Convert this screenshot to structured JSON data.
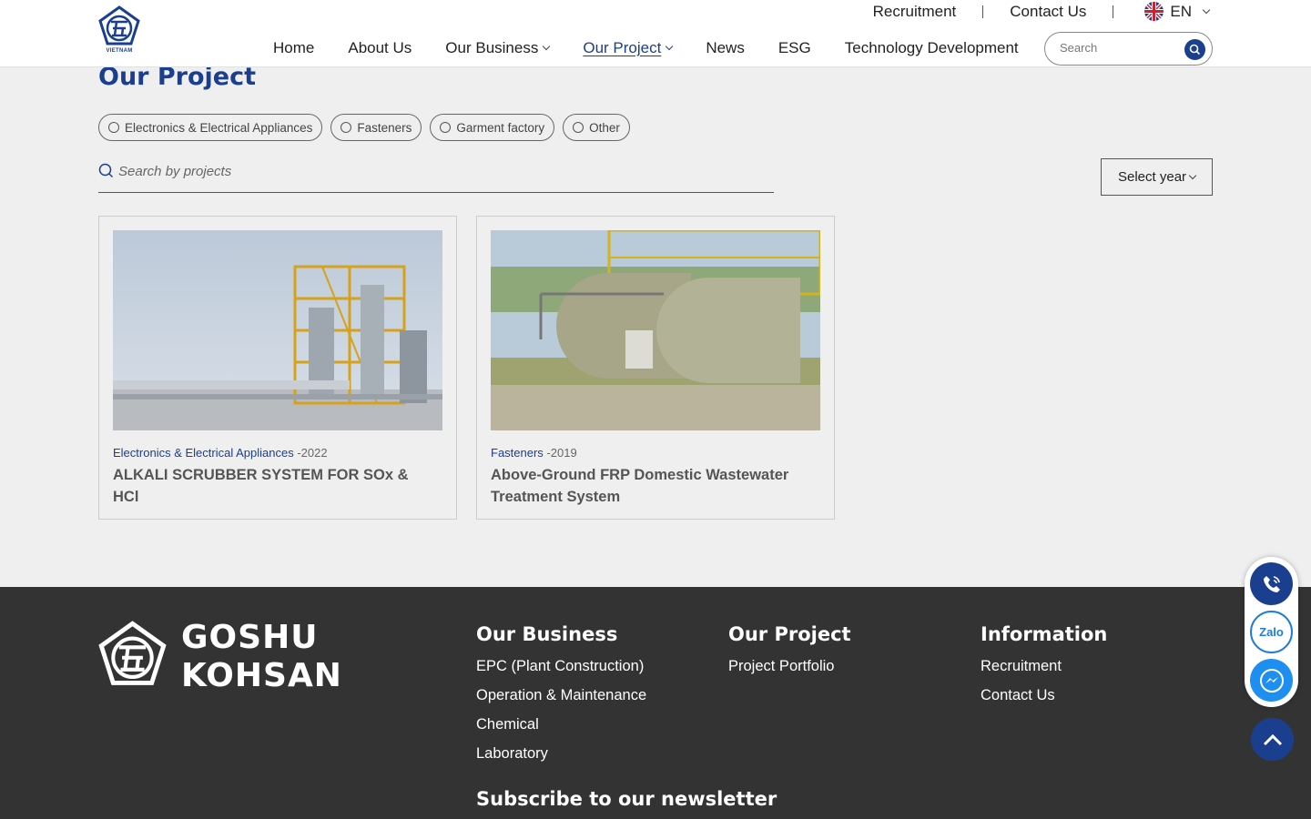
{
  "header": {
    "logo_caption": "VIETNAM",
    "top_links": [
      "Recruitment",
      "Contact Us"
    ],
    "language": "EN",
    "nav": [
      {
        "label": "Home",
        "dropdown": false,
        "active": false
      },
      {
        "label": "About Us",
        "dropdown": false,
        "active": false
      },
      {
        "label": "Our Business",
        "dropdown": true,
        "active": false
      },
      {
        "label": "Our Project",
        "dropdown": true,
        "active": true
      },
      {
        "label": "News",
        "dropdown": false,
        "active": false
      },
      {
        "label": "ESG",
        "dropdown": false,
        "active": false
      },
      {
        "label": "Technology Development",
        "dropdown": false,
        "active": false
      }
    ],
    "search_placeholder": "Search"
  },
  "main": {
    "title": "Our Project",
    "filters": [
      "Electronics & Electrical Appliances",
      "Fasteners",
      "Garment factory",
      "Other"
    ],
    "search_placeholder": "Search by projects",
    "year_select": "Select year",
    "projects": [
      {
        "category": "Electronics & Electrical Appliances",
        "year": "-2022",
        "title": "ALKALI SCRUBBER SYSTEM FOR SOx & HCl"
      },
      {
        "category": "Fasteners",
        "year": "-2019",
        "title": "Above-Ground FRP Domestic Wastewater Treatment System"
      }
    ]
  },
  "footer": {
    "brand_line1": "GOSHU",
    "brand_line2": "KOHSAN",
    "columns": [
      {
        "heading": "Our Business",
        "links": [
          "EPC (Plant Construction)",
          "Operation & Maintenance",
          "Chemical",
          "Laboratory"
        ]
      },
      {
        "heading": "Our Project",
        "links": [
          "Project Portfolio"
        ]
      },
      {
        "heading": "Information",
        "links": [
          "Recruitment",
          "Contact Us"
        ]
      }
    ],
    "newsletter_heading": "Subscribe to our newsletter"
  },
  "floating": {
    "zalo_label": "Zalo"
  },
  "colors": {
    "brand_blue": "#1b3f8f",
    "footer_bg": "#333333",
    "page_bg": "#efefef"
  }
}
